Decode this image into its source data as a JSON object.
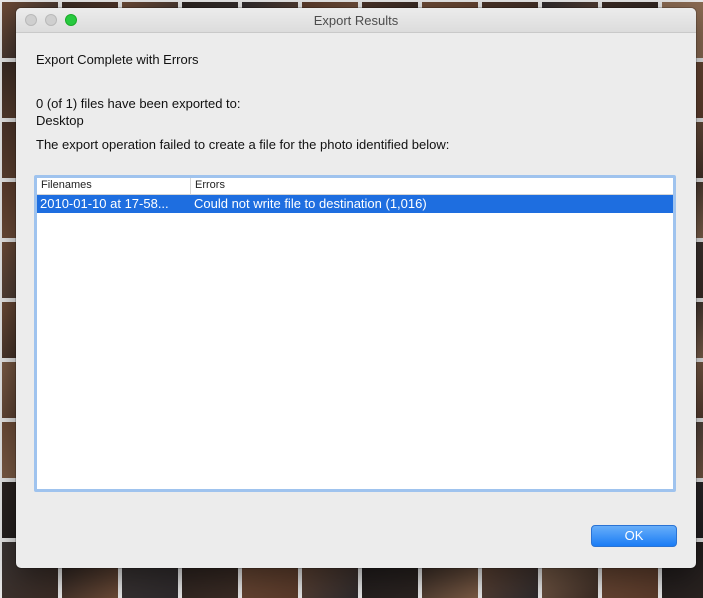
{
  "window": {
    "title": "Export Results"
  },
  "dialog": {
    "heading": "Export Complete with Errors",
    "summary_line": "0 (of 1) files have been exported to:",
    "destination": "Desktop",
    "failure_message": "The export operation failed to create a file for the photo identified below:"
  },
  "results_table": {
    "columns": [
      "Filenames",
      "Errors"
    ],
    "rows": [
      {
        "filename": "2010-01-10 at 17-58...",
        "error": "Could not write file to destination (1,016)",
        "selected": true
      }
    ]
  },
  "buttons": {
    "ok_label": "OK"
  },
  "colors": {
    "selection": "#1e6ee0",
    "accent_button": "#1a7cf5",
    "zoom_button": "#27c93f"
  }
}
